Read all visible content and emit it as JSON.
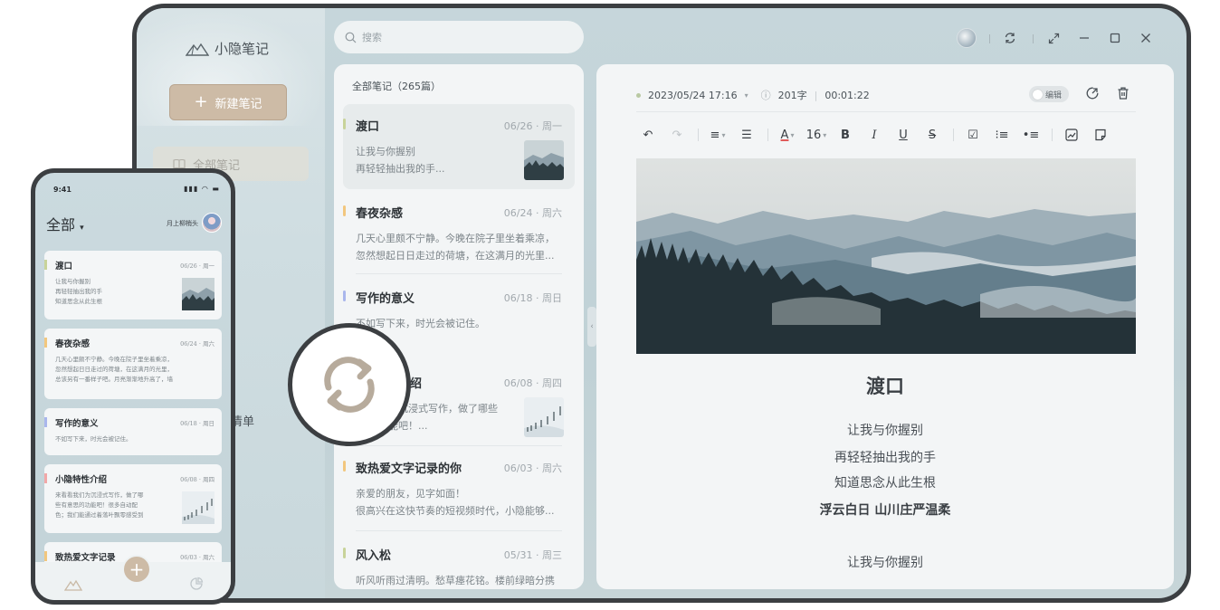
{
  "app": {
    "name": "小隐笔记"
  },
  "sidebar": {
    "new_note_label": "新建笔记",
    "all_notes_label": "全部笔记",
    "peek_label": "清单"
  },
  "search": {
    "placeholder": "搜索"
  },
  "note_list": {
    "header": "全部笔记（265篇）",
    "items": [
      {
        "title": "渡口",
        "date": "06/26 · 周一",
        "lines": [
          "让我与你握别",
          "再轻轻抽出我的手..."
        ],
        "accent": "#c8d39a"
      },
      {
        "title": "春夜杂感",
        "date": "06/24 · 周六",
        "lines": [
          "几天心里颇不宁静。今晚在院子里坐着乘凉，",
          "忽然想起日日走过的荷塘，在这满月的光里..."
        ],
        "accent": "#f2c77e"
      },
      {
        "title": "写作的意义",
        "date": "06/18 · 周日",
        "lines": [
          "不如写下来，时光会被记住。"
        ],
        "accent": "#a9b6ec"
      },
      {
        "title": "绍",
        "date": "06/08 · 周四",
        "lines": [
          "为沉浸式写作，做了哪些",
          "能吧！..."
        ],
        "accent": "#f2a8a8"
      },
      {
        "title": "致热爱文字记录的你",
        "date": "06/03 · 周六",
        "lines": [
          "亲爱的朋友，见字如面！",
          "很高兴在这快节奏的短视频时代，小隐能够..."
        ],
        "accent": "#f2c77e"
      },
      {
        "title": "风入松",
        "date": "05/31 · 周三",
        "lines": [
          "听风听雨过清明。愁草瘗花铭。楼前绿暗分携"
        ],
        "accent": "#c8d39a"
      }
    ]
  },
  "editor": {
    "datetime": "2023/05/24 17:16",
    "word_count": "201字",
    "duration": "00:01:22",
    "edit_label": "编辑",
    "font_size": "16",
    "title": "渡口",
    "lines": [
      "让我与你握别",
      "再轻轻抽出我的手",
      "知道思念从此生根",
      "浮云白日 山川庄严温柔",
      "让我与你握别"
    ]
  },
  "phone": {
    "time": "9:41",
    "title": "全部",
    "user": "月上柳梢头",
    "cards": [
      {
        "title": "渡口",
        "date": "06/26 · 周一",
        "lines": [
          "让我与你握别",
          "再轻轻抽出我的手",
          "知道思念从此生根"
        ],
        "accent": "#c8d39a"
      },
      {
        "title": "春夜杂感",
        "date": "06/24 · 周六",
        "lines": [
          "几天心里颇不宁静。今晚在院子里坐着乘凉，",
          "忽然想起日日走过的荷塘，在这满月的光里，",
          "总该另有一番样子吧。月亮渐渐地升高了，墙"
        ],
        "accent": "#f2c77e"
      },
      {
        "title": "写作的意义",
        "date": "06/18 · 周日",
        "lines": [
          "不如写下来，时光会被记住。"
        ],
        "accent": "#a9b6ec"
      },
      {
        "title": "小隐特性介绍",
        "date": "06/08 · 周四",
        "lines": [
          "来看看我们为沉浸式写作，做了哪",
          "些有意思的功能吧！很多自动配",
          "色；我们能通过着落叶飘零感受到"
        ],
        "accent": "#f2a8a8"
      },
      {
        "title": "致热爱文字记录",
        "date": "06/03 · 周六",
        "lines": [],
        "accent": "#f2c77e"
      }
    ]
  },
  "icons": [
    "mountain-logo-icon",
    "search-icon",
    "book-icon",
    "sync-icon",
    "expand-icon",
    "minimize-icon",
    "maximize-icon",
    "close-icon",
    "share-icon",
    "trash-icon",
    "undo-icon",
    "redo-icon",
    "align-icon",
    "indent-icon",
    "font-color-icon",
    "bold-icon",
    "italic-icon",
    "underline-icon",
    "strikethrough-icon",
    "checkbox-icon",
    "ordered-list-icon",
    "bullet-list-icon",
    "image-icon",
    "sticky-note-icon",
    "plus-icon"
  ]
}
